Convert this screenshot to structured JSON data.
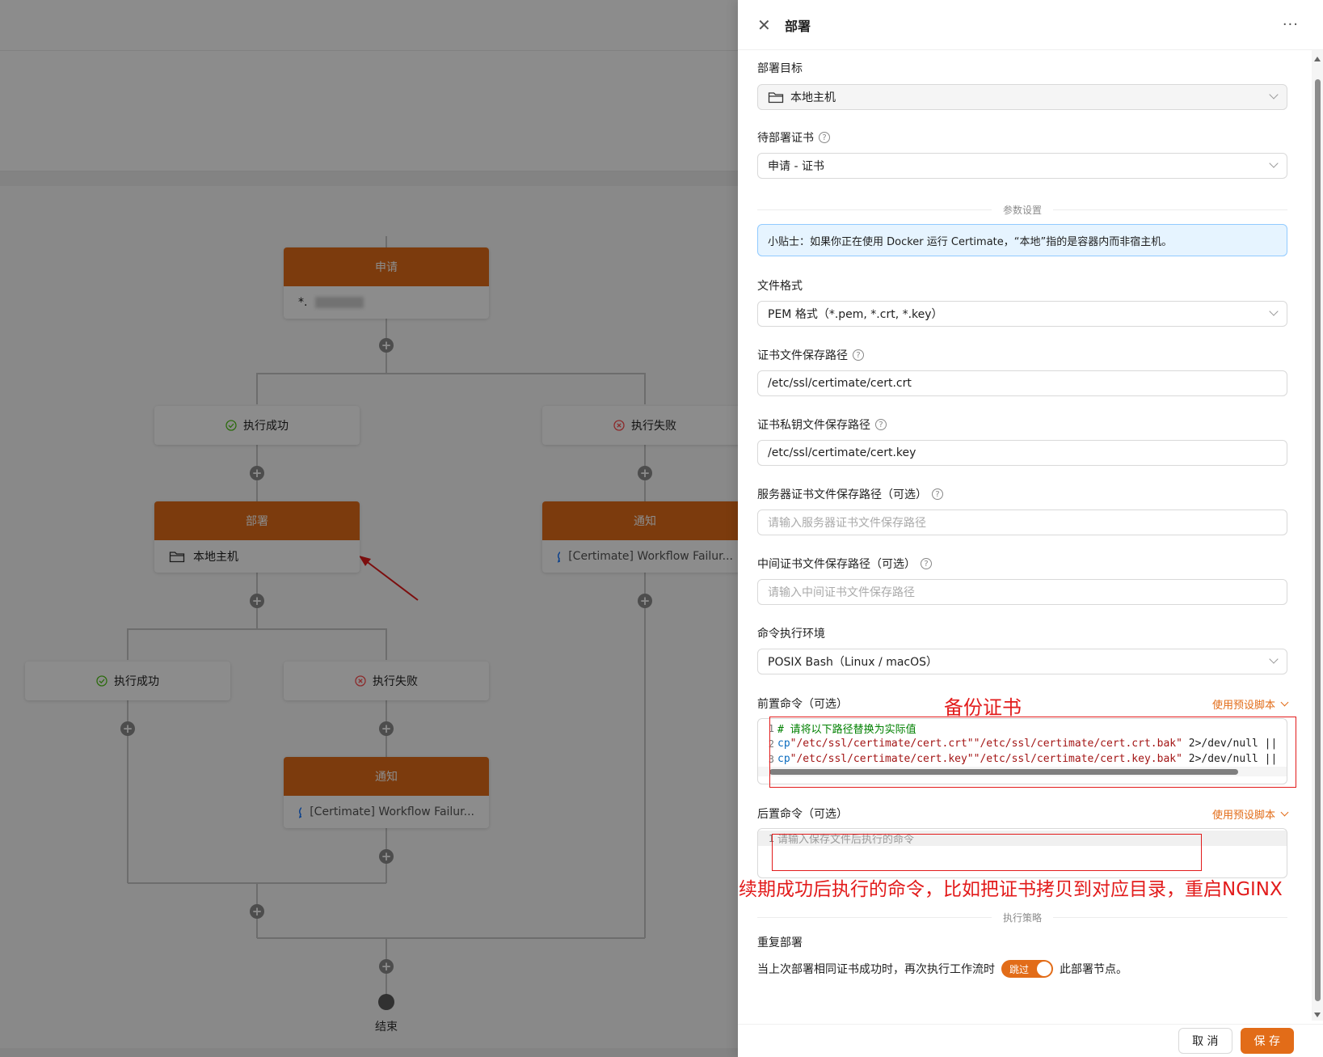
{
  "workflow": {
    "apply_node": {
      "title": "申请",
      "value": "*."
    },
    "branch_success": "执行成功",
    "branch_fail": "执行失败",
    "deploy_node": {
      "title": "部署",
      "value": "本地主机"
    },
    "notify_node": {
      "title": "通知",
      "value": "[Certimate] Workflow Failur..."
    },
    "end_label": "结束",
    "colors": {
      "node_header": "#e26c18",
      "success": "#52c41a",
      "fail": "#ff4d4f",
      "annotation": "#e21b1b"
    }
  },
  "drawer": {
    "title": "部署",
    "more_icon": "more-icon",
    "target": {
      "label": "部署目标",
      "value": "本地主机",
      "icon": "folder-icon"
    },
    "cert": {
      "label": "待部署证书",
      "value": "申请 - 证书"
    },
    "params_divider": "参数设置",
    "tip": "小贴士：如果你正在使用 Docker 运行 Certimate，“本地”指的是容器内而非宿主机。",
    "format": {
      "label": "文件格式",
      "value": "PEM 格式（*.pem, *.crt, *.key）"
    },
    "cert_path": {
      "label": "证书文件保存路径",
      "value": "/etc/ssl/certimate/cert.crt"
    },
    "key_path": {
      "label": "证书私钥文件保存路径",
      "value": "/etc/ssl/certimate/cert.key"
    },
    "server_cert_path": {
      "label": "服务器证书文件保存路径（可选）",
      "placeholder": "请输入服务器证书文件保存路径"
    },
    "inter_cert_path": {
      "label": "中间证书文件保存路径（可选）",
      "placeholder": "请输入中间证书文件保存路径"
    },
    "shell": {
      "label": "命令执行环境",
      "value": "POSIX Bash（Linux / macOS）"
    },
    "pre_cmd": {
      "label": "前置命令（可选）",
      "preset": "使用预设脚本",
      "lines": [
        {
          "n": "1",
          "comment": "# 请将以下路径替换为实际值"
        },
        {
          "n": "2",
          "cmd": "cp",
          "a": "\"/etc/ssl/certimate/cert.crt\"",
          "b": "\"/etc/ssl/certimate/cert.crt.bak\"",
          "tail": " 2>/dev/null ||"
        },
        {
          "n": "3",
          "cmd": "cp",
          "a": "\"/etc/ssl/certimate/cert.key\"",
          "b": "\"/etc/ssl/certimate/cert.key.bak\"",
          "tail": " 2>/dev/null ||"
        }
      ]
    },
    "post_cmd": {
      "label": "后置命令（可选）",
      "preset": "使用预设脚本",
      "line_no": "1",
      "placeholder": "请输入保存文件后执行的命令"
    },
    "policy_divider": "执行策略",
    "repeat": {
      "label": "重复部署",
      "before": "当上次部署相同证书成功时，再次执行工作流时",
      "switch": "跳过",
      "after": "此部署节点。"
    },
    "cancel": "取 消",
    "save": "保 存"
  },
  "annotations": {
    "backup": "备份证书",
    "post_hint": "续期成功后执行的命令，比如把证书拷贝到对应目录，重启NGINX"
  }
}
